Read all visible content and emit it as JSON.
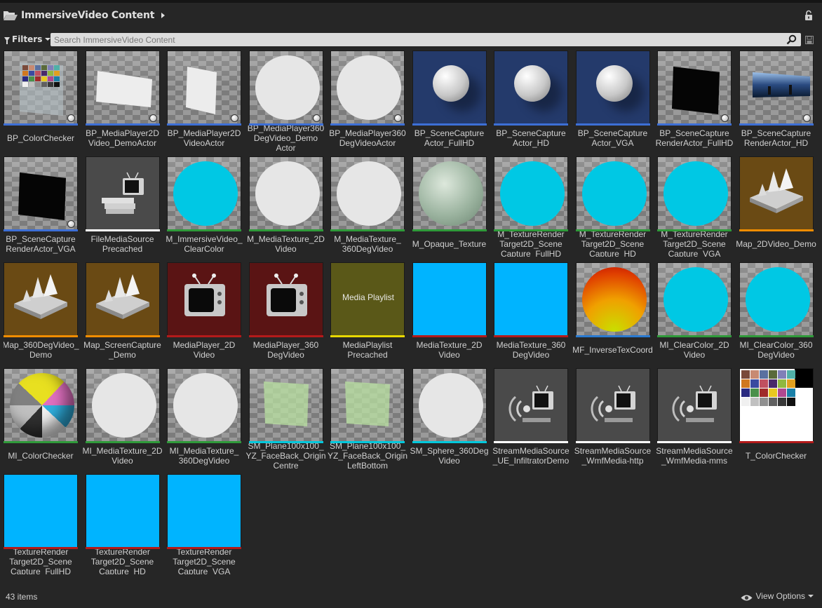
{
  "header": {
    "title": "ImmersiveVideo Content"
  },
  "filterbar": {
    "filters_label": "Filters",
    "search_placeholder": "Search ImmersiveVideo Content",
    "search_value": ""
  },
  "colors": {
    "blueprint": "#3d6fd6",
    "material": "#2f9a3a",
    "texture": "#b41a1a",
    "map": "#f08c00",
    "media_source": "#ffffff",
    "media_player": "#b41a1a",
    "playlist": "#e8d800",
    "render_target": "#b41a1a",
    "static_mesh": "#00c8dc",
    "function": "#2a7ad0",
    "instance": "#2f9a3a"
  },
  "assets": [
    {
      "label": "BP_ColorChecker",
      "thumb": "colorchecker-panel",
      "type": "blueprint"
    },
    {
      "label": "BP_MediaPlayer2DVideo_DemoActor",
      "thumb": "white-panel",
      "type": "blueprint"
    },
    {
      "label": "BP_MediaPlayer2DVideoActor",
      "thumb": "white-panel-tall",
      "type": "blueprint"
    },
    {
      "label": "BP_MediaPlayer360DegVideo_DemoActor",
      "thumb": "white-disc",
      "type": "blueprint"
    },
    {
      "label": "BP_MediaPlayer360DegVideoActor",
      "thumb": "white-disc",
      "type": "blueprint"
    },
    {
      "label": "BP_SceneCaptureActor_FullHD",
      "thumb": "blue-sphere",
      "type": "blueprint"
    },
    {
      "label": "BP_SceneCaptureActor_HD",
      "thumb": "blue-sphere",
      "type": "blueprint"
    },
    {
      "label": "BP_SceneCaptureActor_VGA",
      "thumb": "blue-sphere",
      "type": "blueprint"
    },
    {
      "label": "BP_SceneCaptureRenderActor_FullHD",
      "thumb": "black-panel",
      "type": "blueprint"
    },
    {
      "label": "BP_SceneCaptureRenderActor_HD",
      "thumb": "scene-panel",
      "type": "blueprint"
    },
    {
      "label": "BP_SceneCaptureRenderActor_VGA",
      "thumb": "black-panel",
      "type": "blueprint"
    },
    {
      "label": "FileMediaSource Precached",
      "thumb": "tv-stack",
      "type": "media_source"
    },
    {
      "label": "M_ImmersiveVideo_ClearColor",
      "thumb": "cyan-disc",
      "type": "material"
    },
    {
      "label": "M_MediaTexture_2DVideo",
      "thumb": "white-disc",
      "type": "material"
    },
    {
      "label": "M_MediaTexture_360DegVideo",
      "thumb": "white-disc",
      "type": "material"
    },
    {
      "label": "M_Opaque_Texture",
      "thumb": "marble-sphere",
      "type": "material"
    },
    {
      "label": "M_TextureRenderTarget2D_SceneCapture_FullHD",
      "thumb": "cyan-disc",
      "type": "material"
    },
    {
      "label": "M_TextureRenderTarget2D_SceneCapture_HD",
      "thumb": "cyan-disc",
      "type": "material"
    },
    {
      "label": "M_TextureRenderTarget2D_SceneCapture_VGA",
      "thumb": "cyan-disc",
      "type": "material"
    },
    {
      "label": "Map_2DVideo_Demo",
      "thumb": "map",
      "type": "map"
    },
    {
      "label": "Map_360DegVideo_Demo",
      "thumb": "map",
      "type": "map"
    },
    {
      "label": "Map_ScreenCapture_Demo",
      "thumb": "map",
      "type": "map"
    },
    {
      "label": "MediaPlayer_2DVideo",
      "thumb": "tv-red",
      "type": "media_player"
    },
    {
      "label": "MediaPlayer_360DegVideo",
      "thumb": "tv-red",
      "type": "media_player"
    },
    {
      "label": "MediaPlaylist Precached",
      "thumb": "playlist",
      "type": "playlist"
    },
    {
      "label": "MediaTexture_2DVideo",
      "thumb": "cyan-square",
      "type": "texture"
    },
    {
      "label": "MediaTexture_360DegVideo",
      "thumb": "cyan-square",
      "type": "texture"
    },
    {
      "label": "MF_InverseTexCoord",
      "thumb": "gradient-disc",
      "type": "function"
    },
    {
      "label": "MI_ClearColor_2DVideo",
      "thumb": "cyan-disc",
      "type": "instance"
    },
    {
      "label": "MI_ClearColor_360DegVideo",
      "thumb": "cyan-disc",
      "type": "instance"
    },
    {
      "label": "MI_ColorChecker",
      "thumb": "color-sphere",
      "type": "instance"
    },
    {
      "label": "MI_MediaTexture_2DVideo",
      "thumb": "white-disc",
      "type": "instance"
    },
    {
      "label": "MI_MediaTexture_360DegVideo",
      "thumb": "white-disc",
      "type": "instance"
    },
    {
      "label": "SM_Plane100x100_YZ_FaceBack_OriginCentre",
      "thumb": "green-plane",
      "type": "static_mesh"
    },
    {
      "label": "SM_Plane100x100_YZ_FaceBack_OriginLeftBottom",
      "thumb": "green-plane",
      "type": "static_mesh"
    },
    {
      "label": "SM_Sphere_360DegVideo",
      "thumb": "white-disc-plain",
      "type": "static_mesh"
    },
    {
      "label": "StreamMediaSource_UE_InfiltratorDemo",
      "thumb": "stream",
      "type": "media_source"
    },
    {
      "label": "StreamMediaSource_WmfMedia-http",
      "thumb": "stream",
      "type": "media_source"
    },
    {
      "label": "StreamMediaSource_WmfMedia-mms",
      "thumb": "stream",
      "type": "media_source"
    },
    {
      "label": "T_ColorChecker",
      "thumb": "colorchecker-tex",
      "type": "texture"
    },
    {
      "label": "TextureRenderTarget2D_SceneCapture_FullHD",
      "thumb": "cyan-square",
      "type": "render_target"
    },
    {
      "label": "TextureRenderTarget2D_SceneCapture_HD",
      "thumb": "cyan-square",
      "type": "render_target"
    },
    {
      "label": "TextureRenderTarget2D_SceneCapture_VGA",
      "thumb": "cyan-square",
      "type": "render_target"
    }
  ],
  "labels_display": [
    "BP_ColorChecker",
    "BP_MediaPlayer2D\nVideo_DemoActor",
    "BP_MediaPlayer2D\nVideoActor",
    "BP_MediaPlayer360\nDegVideo_Demo\nActor",
    "BP_MediaPlayer360\nDegVideoActor",
    "BP_SceneCapture\nActor_FullHD",
    "BP_SceneCapture\nActor_HD",
    "BP_SceneCapture\nActor_VGA",
    "BP_SceneCapture\nRenderActor_FullHD",
    "BP_SceneCapture\nRenderActor_HD",
    "BP_SceneCapture\nRenderActor_VGA",
    "FileMediaSource\nPrecached",
    "M_ImmersiveVideo_\nClearColor",
    "M_MediaTexture_2D\nVideo",
    "M_MediaTexture_\n360DegVideo",
    "M_Opaque_Texture",
    "M_TextureRender\nTarget2D_Scene\nCapture_FullHD",
    "M_TextureRender\nTarget2D_Scene\nCapture_HD",
    "M_TextureRender\nTarget2D_Scene\nCapture_VGA",
    "Map_2DVideo_Demo",
    "Map_360DegVideo_\nDemo",
    "Map_ScreenCapture\n_Demo",
    "MediaPlayer_2D\nVideo",
    "MediaPlayer_360\nDegVideo",
    "MediaPlaylist\nPrecached",
    "MediaTexture_2D\nVideo",
    "MediaTexture_360\nDegVideo",
    "MF_InverseTexCoord",
    "MI_ClearColor_2D\nVideo",
    "MI_ClearColor_360\nDegVideo",
    "MI_ColorChecker",
    "MI_MediaTexture_2D\nVideo",
    "MI_MediaTexture_\n360DegVideo",
    "SM_Plane100x100_\nYZ_FaceBack_Origin\nCentre",
    "SM_Plane100x100_\nYZ_FaceBack_Origin\nLeftBottom",
    "SM_Sphere_360Deg\nVideo",
    "StreamMediaSource\n_UE_InfiltratorDemo",
    "StreamMediaSource\n_WmfMedia-http",
    "StreamMediaSource\n_WmfMedia-mms",
    "T_ColorChecker",
    "TextureRender\nTarget2D_Scene\nCapture_FullHD",
    "TextureRender\nTarget2D_Scene\nCapture_HD",
    "TextureRender\nTarget2D_Scene\nCapture_VGA"
  ],
  "playlist_thumb_text": "Media Playlist",
  "status": {
    "item_count": "43 items",
    "view_options": "View Options"
  }
}
